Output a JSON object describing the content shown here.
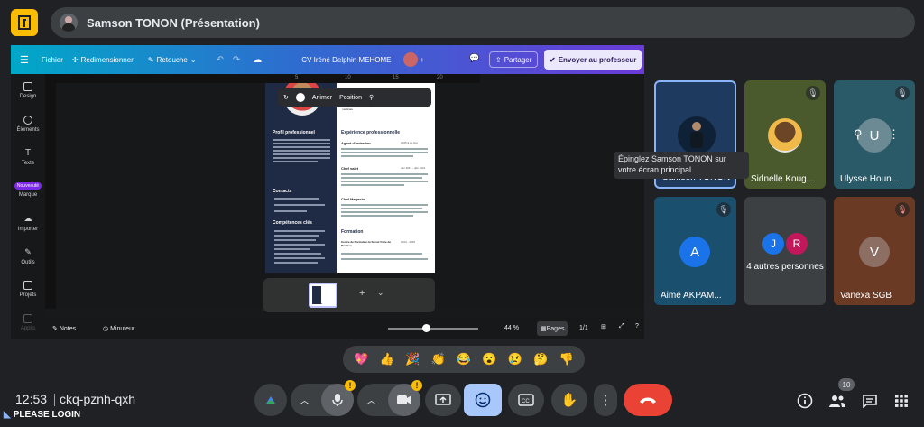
{
  "header": {
    "presenter_title": "Samson TONON (Présentation)"
  },
  "canva": {
    "menu_file": "Fichier",
    "menu_resize": "Redimensionner",
    "menu_edit": "Retouche",
    "doc_title": "CV Iréné Delphin MEHOME",
    "share": "Partager",
    "send_teacher": "Envoyer au professeur",
    "sidebar": [
      {
        "label": "Design",
        "name": "design"
      },
      {
        "label": "Éléments",
        "name": "elements"
      },
      {
        "label": "Texte",
        "name": "texte"
      },
      {
        "label": "Marque",
        "name": "marque"
      },
      {
        "label": "Importer",
        "name": "importer"
      },
      {
        "label": "Outils",
        "name": "outils"
      },
      {
        "label": "Projets",
        "name": "projets"
      },
      {
        "label": "Applis",
        "name": "applis"
      }
    ],
    "new_badge": "Nouveauté",
    "float_toolbar": {
      "animate": "Animer",
      "position": "Position"
    },
    "ruler": [
      "5",
      "10",
      "15",
      "20"
    ],
    "notes": "Notes",
    "timer": "Minuteur",
    "zoom": "44 %",
    "pages": "Pages",
    "page_count": "1/1",
    "page_thumb_num": "1",
    "resume": {
      "subtitle": "Délégué Médical Junior | En reconversion – Formé à la communication médicale",
      "profile": "Profil professionnel",
      "contacts": "Contacts",
      "skills": "Compétences clés",
      "experience": "Expérience professionnelle",
      "job1": "Agent d'entretien",
      "job1_date": "2025 à ce jour",
      "job2": "Chef valet",
      "job2_date": "déc 2017 - déc 2021",
      "job3": "Chef Magasin",
      "formation": "Formation",
      "formation1": "Centre de Formation la Savoir Faire de Parakou",
      "formation1_date": "2024 - 2025"
    }
  },
  "tooltip": "Épinglez Samson TONON sur votre écran principal",
  "tiles": [
    {
      "name": "Samson TONON",
      "bg": "#1e3a5f"
    },
    {
      "name": "Sidnelle Koug...",
      "bg": "#4a5a2c"
    },
    {
      "name": "Ulysse Houn...",
      "bg": "#2a5a68"
    },
    {
      "name": "Aimé AKPAM...",
      "bg": "#1a4f6e",
      "initial": "A"
    },
    {
      "name": "4 autres personnes",
      "bg": "#3c4043",
      "initials": [
        "J",
        "R"
      ]
    },
    {
      "name": "Vanexa SGB",
      "bg": "#6a3a24",
      "initial": "V"
    }
  ],
  "ulysse_initial": "U",
  "reactions": [
    "💖",
    "👍",
    "🎉",
    "👏",
    "😂",
    "😮",
    "😢",
    "🤔",
    "👎"
  ],
  "footer": {
    "time": "12:53",
    "meeting_code": "ckq-pznh-qxh",
    "please_login": "PLEASE LOGIN",
    "participants_count": "10"
  },
  "colors": {
    "accent": "#8ab4f8",
    "hangup": "#ea4335",
    "warning": "#fbbc04"
  }
}
